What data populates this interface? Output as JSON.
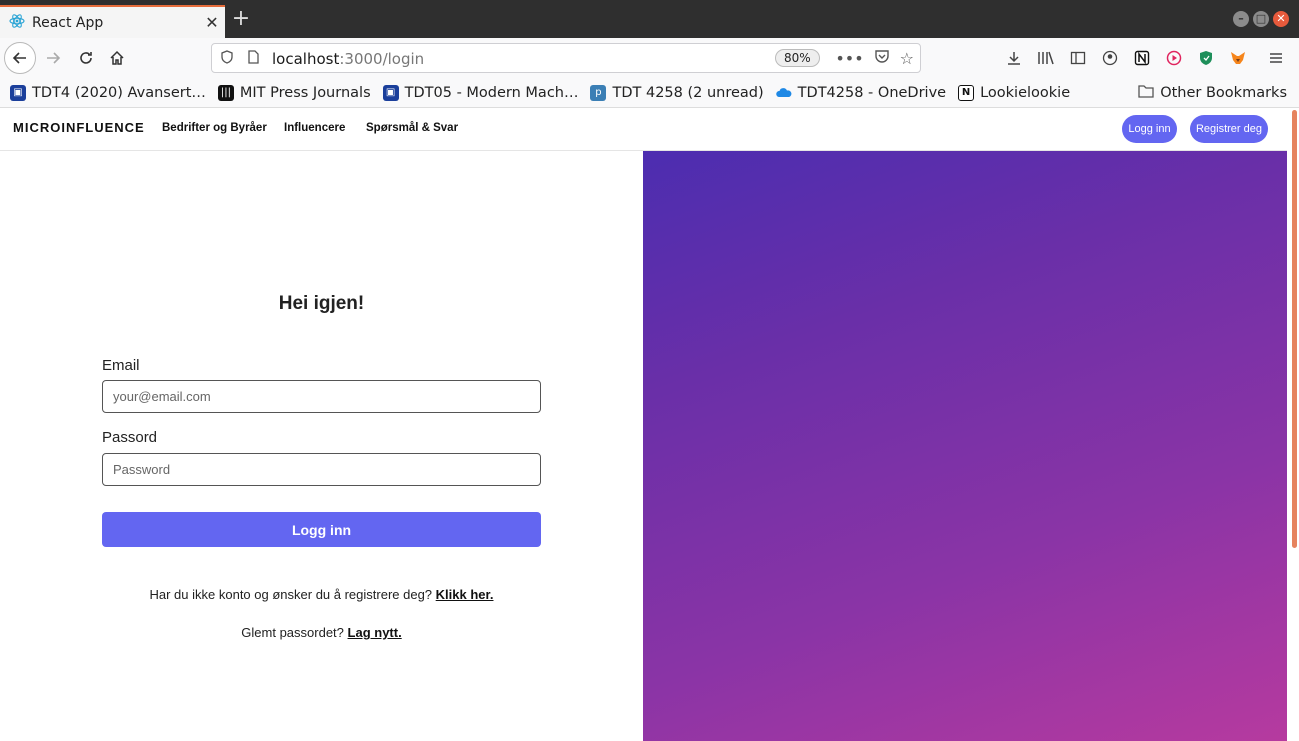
{
  "browser": {
    "tab_title": "React App",
    "url_host": "localhost",
    "url_rest": ":3000/login",
    "zoom": "80%",
    "bookmarks": [
      {
        "label": "TDT4 (2020) Avansert…",
        "color": "#1b3f9b"
      },
      {
        "label": "MIT Press Journals",
        "color": "#111111"
      },
      {
        "label": "TDT05 - Modern Mach…",
        "color": "#1b3f9b"
      },
      {
        "label": "TDT 4258 (2 unread)",
        "color": "#3b7fb5"
      },
      {
        "label": "TDT4258 - OneDrive",
        "color": "#1e88e5"
      },
      {
        "label": "Lookielookie",
        "color": "#111111"
      }
    ],
    "other_bookmarks": "Other Bookmarks"
  },
  "site": {
    "brand": "MICROINFLUENCE",
    "nav": [
      "Bedrifter og Byråer",
      "Influencere",
      "Spørsmål & Svar"
    ],
    "login_button": "Logg inn",
    "register_button": "Registrer deg"
  },
  "login": {
    "heading": "Hei igjen!",
    "email_label": "Email",
    "email_placeholder": "your@email.com",
    "password_label": "Passord",
    "password_placeholder": "Password",
    "submit_label": "Logg inn",
    "register_prompt": "Har du ikke konto og ønsker du å registrere deg?",
    "register_link": "Klikk her.",
    "forgot_prompt": "Glemt passordet?",
    "forgot_link": "Lag nytt."
  },
  "colors": {
    "accent": "#6366f1",
    "gradient_start": "#4c2db0",
    "gradient_end": "#b63a9f",
    "tab_highlight": "#e66c3b"
  }
}
